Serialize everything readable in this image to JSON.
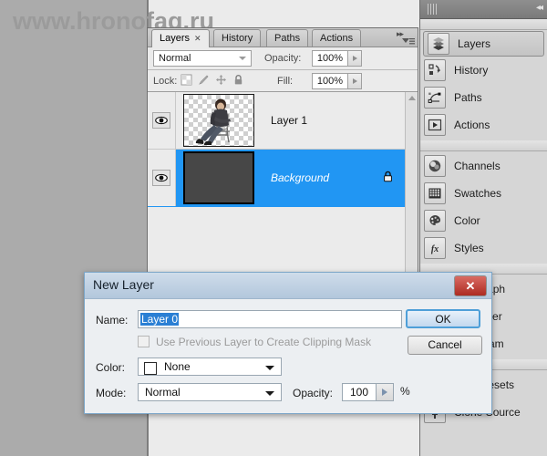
{
  "watermark": "www.hronofag.ru",
  "layers_panel": {
    "tabs": [
      {
        "label": "Layers",
        "active": true,
        "closable": true
      },
      {
        "label": "History",
        "active": false,
        "closable": false
      },
      {
        "label": "Paths",
        "active": false,
        "closable": false
      },
      {
        "label": "Actions",
        "active": false,
        "closable": false
      }
    ],
    "blend_mode": "Normal",
    "opacity_label": "Opacity:",
    "opacity_value": "100%",
    "lock_label": "Lock:",
    "fill_label": "Fill:",
    "fill_value": "100%",
    "lock_icons": [
      "lock-transparency-icon",
      "lock-image-icon",
      "lock-position-icon",
      "lock-all-icon"
    ],
    "layers": [
      {
        "name": "Layer 1",
        "selected": false,
        "locked": false,
        "thumb": "person-on-chair-transparent"
      },
      {
        "name": "Background",
        "selected": true,
        "locked": true,
        "thumb": "dark-gray-solid"
      }
    ]
  },
  "dock": {
    "collapse_icon": "collapse-arrows-icon",
    "groups": [
      {
        "items": [
          {
            "label": "Layers",
            "icon": "layers-icon",
            "active": true
          },
          {
            "label": "History",
            "icon": "history-icon",
            "active": false
          },
          {
            "label": "Paths",
            "icon": "paths-icon",
            "active": false
          },
          {
            "label": "Actions",
            "icon": "actions-play-icon",
            "active": false
          }
        ]
      },
      {
        "items": [
          {
            "label": "Channels",
            "icon": "channels-icon",
            "active": false
          },
          {
            "label": "Swatches",
            "icon": "swatches-grid-icon",
            "active": false
          },
          {
            "label": "Color",
            "icon": "color-palette-icon",
            "active": false
          },
          {
            "label": "Styles",
            "icon": "styles-fx-icon",
            "active": false
          }
        ]
      },
      {
        "items": [
          {
            "label": "Paragraph",
            "icon": "paragraph-pilcrow-icon",
            "active": false
          },
          {
            "label": "Character",
            "icon": "character-icon",
            "active": false
          },
          {
            "label": "Histogram",
            "icon": "histogram-icon",
            "active": false
          }
        ]
      },
      {
        "items": [
          {
            "label": "Tool Presets",
            "icon": "tool-presets-icon",
            "active": false
          },
          {
            "label": "Clone Source",
            "icon": "clone-source-icon",
            "active": false
          }
        ]
      }
    ]
  },
  "dialog": {
    "title": "New Layer",
    "close_icon": "close-x-icon",
    "name_label": "Name:",
    "name_value": "Layer 0",
    "clipping_label": "Use Previous Layer to Create Clipping Mask",
    "clipping_checked": false,
    "color_label": "Color:",
    "color_value": "None",
    "mode_label": "Mode:",
    "mode_value": "Normal",
    "opacity_label": "Opacity:",
    "opacity_value": "100",
    "percent_sign": "%",
    "ok_label": "OK",
    "cancel_label": "Cancel"
  }
}
